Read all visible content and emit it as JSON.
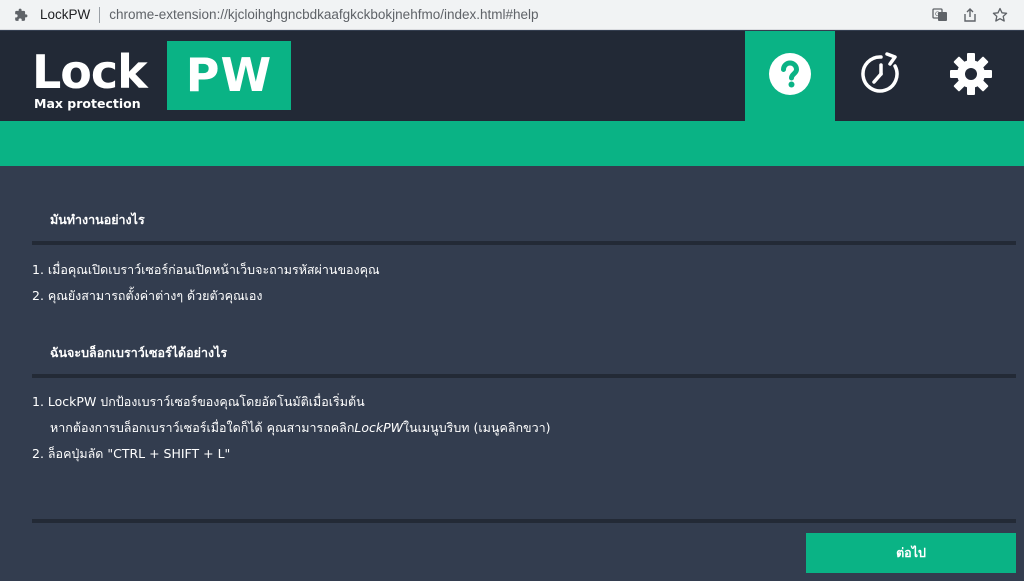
{
  "browser": {
    "site_name": "LockPW",
    "url": "chrome-extension://kjcloihghgncbdkaafgkckbokjnehfmo/index.html#help"
  },
  "logo": {
    "lock_text": "Lock",
    "pw_text": "PW",
    "subtitle": "Max protection"
  },
  "nav": {
    "items": [
      {
        "name": "help",
        "icon": "question-circle-icon",
        "active": true
      },
      {
        "name": "history",
        "icon": "history-clock-icon",
        "active": false
      },
      {
        "name": "settings",
        "icon": "gear-icon",
        "active": false
      }
    ]
  },
  "colors": {
    "accent": "#0ab385",
    "header_bg": "#222936",
    "content_bg": "#333d4f"
  },
  "section1": {
    "title": "มันทำงานอย่างไร",
    "items": [
      "1. เมื่อคุณเปิดเบราว์เซอร์ก่อนเปิดหน้าเว็บจะถามรหัสผ่านของคุณ",
      "2. คุณยังสามารถตั้งค่าต่างๆ ด้วยตัวคุณเอง"
    ]
  },
  "section2": {
    "title": "ฉันจะบล็อกเบราว์เซอร์ได้อย่างไร",
    "item1": "1. LockPW ปกป้องเบราว์เซอร์ของคุณโดยอัตโนมัติเมื่อเริ่มต้น",
    "item1_cont_before": "หากต้องการบล็อกเบราว์เซอร์เมื่อใดก็ได้ คุณสามารถคลิก",
    "item1_cont_em": "LockPW",
    "item1_cont_after": "ในเมนูบริบท (เมนูคลิกขวา)",
    "item2": "2. ล็อคปุ่มลัด \"CTRL + SHIFT + L\""
  },
  "footer": {
    "next_label": "ต่อไป"
  }
}
